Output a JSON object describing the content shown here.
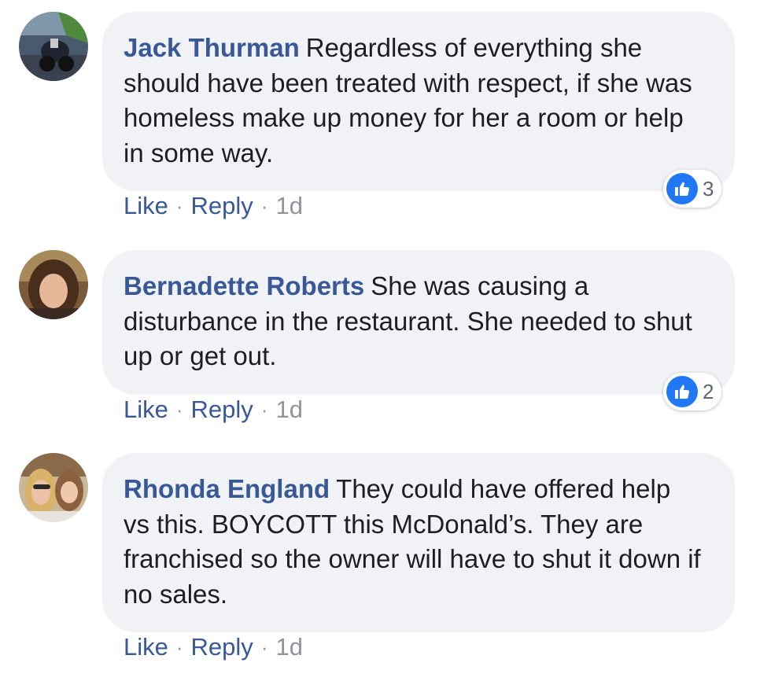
{
  "comments": [
    {
      "author": "Jack Thurman",
      "text": "Regardless of everything she should have been treated with respect, if she was homeless make up money for her a room or help in some way.",
      "reaction_count": "3",
      "actions": {
        "like": "Like",
        "reply": "Reply",
        "time": "1d"
      },
      "avatar_icon": "motorcycle-photo"
    },
    {
      "author": "Bernadette Roberts",
      "text": "She was causing a disturbance in the restaurant. She needed to shut up or get out.",
      "reaction_count": "2",
      "actions": {
        "like": "Like",
        "reply": "Reply",
        "time": "1d"
      },
      "avatar_icon": "portrait-photo"
    },
    {
      "author": "Rhonda England",
      "text": "They could have offered help vs this. BOYCOTT this McDonald’s. They are franchised so the owner will have to shut it down if no sales.",
      "actions": {
        "like": "Like",
        "reply": "Reply",
        "time": "1d"
      },
      "avatar_icon": "group-photo"
    }
  ],
  "separator": "·",
  "colors": {
    "author": "#385898",
    "bubble": "#f0f2f5",
    "like_badge": "#2078f4",
    "muted": "#90949c"
  }
}
